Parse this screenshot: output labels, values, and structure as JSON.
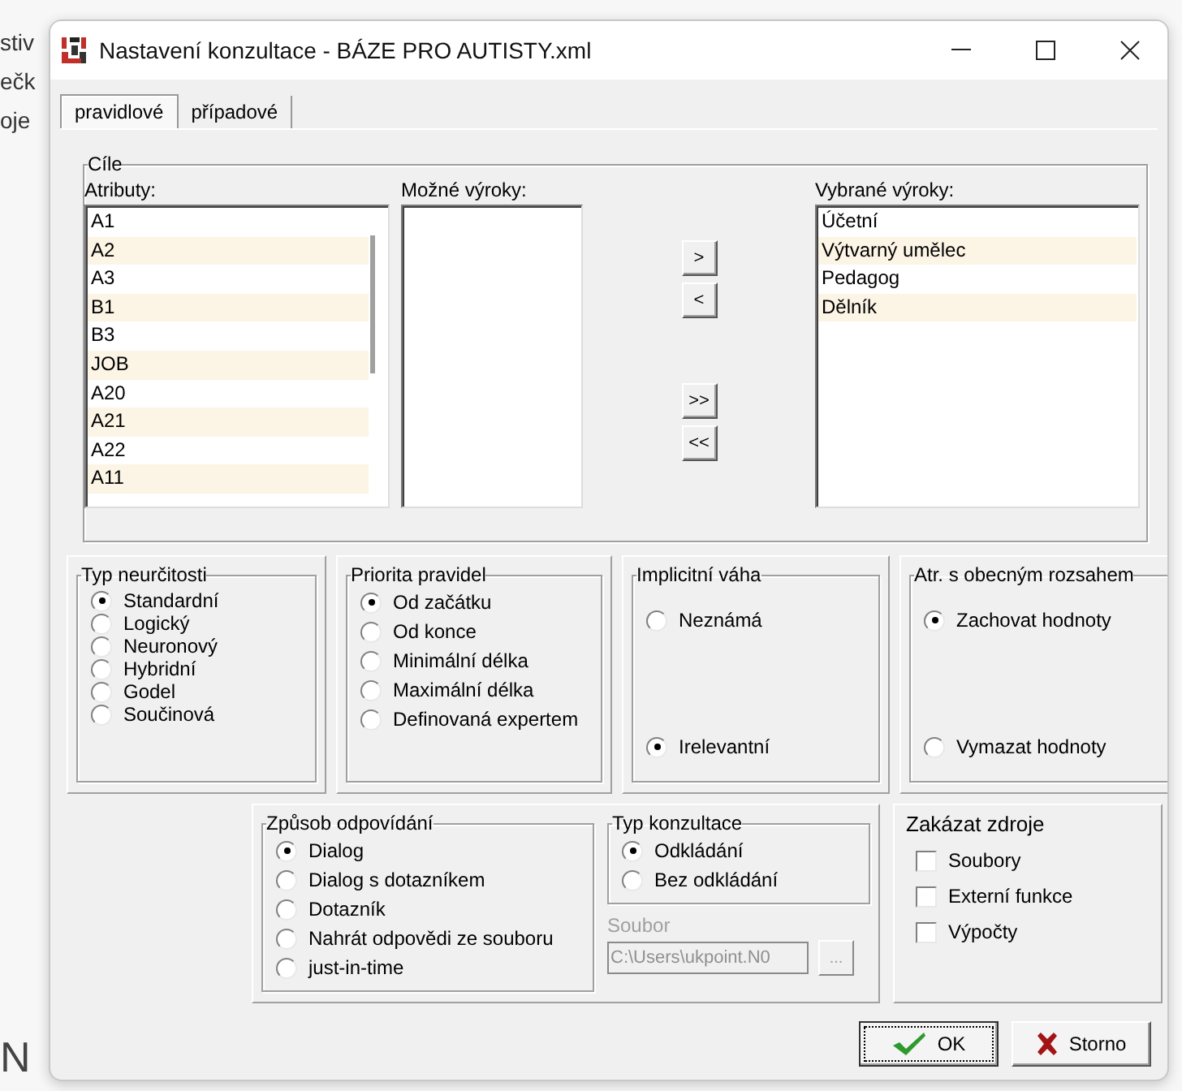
{
  "background": {
    "fragments": [
      "stiv",
      "ečk",
      "oje",
      "N"
    ]
  },
  "window": {
    "title": "Nastavení konzultace - BÁZE PRO AUTISTY.xml"
  },
  "tabs": [
    {
      "label": "pravidlové",
      "selected": true
    },
    {
      "label": "případové",
      "selected": false
    }
  ],
  "goals": {
    "title": "Cíle",
    "attributes": {
      "label": "Atributy:",
      "items": [
        "A1",
        "A2",
        "A3",
        "B1",
        "B3",
        "JOB",
        "A20",
        "A21",
        "A22",
        "A11"
      ]
    },
    "possible": {
      "label": "Možné výroky:"
    },
    "move_buttons": [
      ">",
      "<",
      ">>",
      "<<"
    ],
    "chosen": {
      "label": "Vybrané výroky:",
      "items": [
        "Účetní",
        "Výtvarný umělec",
        "Pedagog",
        "Dělník"
      ]
    }
  },
  "option_groups": [
    {
      "title": "Typ neurčitosti",
      "kind": "compact",
      "options": [
        {
          "label": "Standardní",
          "selected": true
        },
        {
          "label": "Logický",
          "selected": false
        },
        {
          "label": "Neuronový",
          "selected": false
        },
        {
          "label": "Hybridní",
          "selected": false
        },
        {
          "label": "Godel",
          "selected": false
        },
        {
          "label": "Součinová",
          "selected": false
        }
      ]
    },
    {
      "title": "Priorita pravidel",
      "kind": "roomy",
      "options": [
        {
          "label": "Od začátku",
          "selected": true
        },
        {
          "label": "Od konce",
          "selected": false
        },
        {
          "label": "Minimální délka",
          "selected": false
        },
        {
          "label": "Maximální délka",
          "selected": false
        },
        {
          "label": "Definovaná expertem",
          "selected": false
        }
      ]
    },
    {
      "title": "Implicitní váha",
      "kind": "spread",
      "options": [
        {
          "label": "Neznámá",
          "selected": false
        },
        {
          "label": "Irelevantní",
          "selected": true
        }
      ]
    },
    {
      "title": "Atr. s obecným rozsahem",
      "kind": "spread",
      "options": [
        {
          "label": "Zachovat hodnoty",
          "selected": true
        },
        {
          "label": "Vymazat hodnoty",
          "selected": false
        }
      ]
    }
  ],
  "answer_mode": {
    "title": "Způsob odpovídání",
    "options": [
      {
        "label": "Dialog",
        "selected": true
      },
      {
        "label": "Dialog s dotazníkem",
        "selected": false
      },
      {
        "label": "Dotazník",
        "selected": false
      },
      {
        "label": "Nahrát odpovědi ze souboru",
        "selected": false
      },
      {
        "label": "just-in-time",
        "selected": false
      }
    ]
  },
  "consultation_type": {
    "title": "Typ konzultace",
    "options": [
      {
        "label": "Odkládání",
        "selected": true
      },
      {
        "label": "Bez odkládání",
        "selected": false
      }
    ]
  },
  "file": {
    "label": "Soubor",
    "value": "C:\\Users\\ukpoint.N0",
    "disabled": true,
    "browse": "..."
  },
  "disable_sources": {
    "title": "Zakázat zdroje",
    "options": [
      {
        "label": "Soubory",
        "checked": false
      },
      {
        "label": "Externí funkce",
        "checked": false
      },
      {
        "label": "Výpočty",
        "checked": false
      }
    ]
  },
  "buttons": [
    {
      "label": "OK",
      "kind": "ok",
      "focused": true
    },
    {
      "label": "Storno",
      "kind": "cancel",
      "focused": false
    }
  ]
}
